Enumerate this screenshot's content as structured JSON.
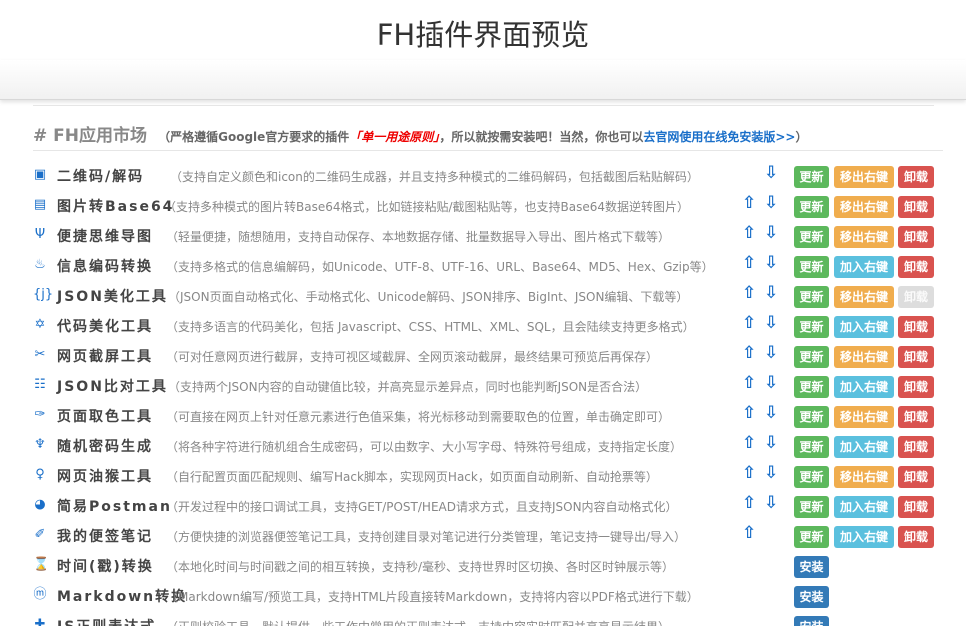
{
  "page_title": "FH插件界面预览",
  "market": {
    "title": "# FH应用市场",
    "note_prefix": "（严格遵循Google官方要求的插件",
    "note_red": "「单一用途原则」",
    "note_mid": "，所以就按需安装吧！当然，你也可以",
    "note_link": "去官网使用在线免安装版>>",
    "note_suffix": "）"
  },
  "labels": {
    "update": "更新",
    "install": "安装",
    "remove_menu": "移出右键",
    "add_menu": "加入右键",
    "uninstall": "卸载",
    "up_arrow": "⇧",
    "down_arrow": "⇩"
  },
  "colors": {
    "update": "#5cb85c",
    "install": "#337ab7",
    "remove_menu": "#f0ad4e",
    "add_menu": "#5bc0de",
    "uninstall": "#d9534f",
    "accent": "#1a6fc9"
  },
  "tools": [
    {
      "icon": "qrcode-icon",
      "glyph": "▣",
      "name": "二维码/解码",
      "desc": "（支持自定义颜色和icon的二维码生成器，并且支持多种模式的二维码解码，包括截图后粘贴解码）",
      "up": false,
      "down": true,
      "status": "installed",
      "menu": "remove",
      "uninstall_enabled": true
    },
    {
      "icon": "image-icon",
      "glyph": "▤",
      "name": "图片转Base64",
      "desc": "（支持多种模式的图片转Base64格式，比如链接粘贴/截图粘贴等，也支持Base64数据逆转图片）",
      "up": true,
      "down": true,
      "status": "installed",
      "menu": "remove",
      "uninstall_enabled": true
    },
    {
      "icon": "mindmap-icon",
      "glyph": "Ψ",
      "name": "便捷思维导图",
      "desc": "（轻量便捷，随想随用，支持自动保存、本地数据存储、批量数据导入导出、图片格式下载等）",
      "up": true,
      "down": true,
      "status": "installed",
      "menu": "remove",
      "uninstall_enabled": true
    },
    {
      "icon": "encode-icon",
      "glyph": "♨",
      "name": "信息编码转换",
      "desc": "（支持多格式的信息编解码，如Unicode、UTF-8、UTF-16、URL、Base64、MD5、Hex、Gzip等）",
      "up": true,
      "down": true,
      "status": "installed",
      "menu": "add",
      "uninstall_enabled": true
    },
    {
      "icon": "json-icon",
      "glyph": "{j}",
      "name": "JSON美化工具",
      "desc": "（JSON页面自动格式化、手动格式化、Unicode解码、JSON排序、BigInt、JSON编辑、下载等）",
      "up": true,
      "down": true,
      "status": "installed",
      "menu": "remove",
      "uninstall_enabled": false
    },
    {
      "icon": "code-icon",
      "glyph": "✡",
      "name": "代码美化工具",
      "desc": "（支持多语言的代码美化，包括 Javascript、CSS、HTML、XML、SQL，且会陆续支持更多格式）",
      "up": true,
      "down": true,
      "status": "installed",
      "menu": "add",
      "uninstall_enabled": true
    },
    {
      "icon": "scissors-icon",
      "glyph": "✂",
      "name": "网页截屏工具",
      "desc": "（可对任意网页进行截屏，支持可视区域截屏、全网页滚动截屏，最终结果可预览后再保存）",
      "up": true,
      "down": true,
      "status": "installed",
      "menu": "remove",
      "uninstall_enabled": true
    },
    {
      "icon": "compare-icon",
      "glyph": "☷",
      "name": "JSON比对工具",
      "desc": "（支持两个JSON内容的自动键值比较，并高亮显示差异点，同时也能判断JSON是否合法）",
      "up": true,
      "down": true,
      "status": "installed",
      "menu": "add",
      "uninstall_enabled": true
    },
    {
      "icon": "color-picker-icon",
      "glyph": "✑",
      "name": "页面取色工具",
      "desc": "（可直接在网页上针对任意元素进行色值采集，将光标移动到需要取色的位置，单击确定即可）",
      "up": true,
      "down": true,
      "status": "installed",
      "menu": "remove",
      "uninstall_enabled": true
    },
    {
      "icon": "key-icon",
      "glyph": "♆",
      "name": "随机密码生成",
      "desc": "（将各种字符进行随机组合生成密码，可以由数字、大小写字母、特殊符号组成，支持指定长度）",
      "up": true,
      "down": true,
      "status": "installed",
      "menu": "add",
      "uninstall_enabled": true
    },
    {
      "icon": "monkey-icon",
      "glyph": "♀",
      "name": "网页油猴工具",
      "desc": "（自行配置页面匹配规则、编写Hack脚本，实现网页Hack，如页面自动刷新、自动抢票等）",
      "up": true,
      "down": true,
      "status": "installed",
      "menu": "remove",
      "uninstall_enabled": true
    },
    {
      "icon": "postman-icon",
      "glyph": "◕",
      "name": "简易Postman",
      "desc": "（开发过程中的接口调试工具，支持GET/POST/HEAD请求方式，且支持JSON内容自动格式化）",
      "up": true,
      "down": true,
      "status": "installed",
      "menu": "add",
      "uninstall_enabled": true
    },
    {
      "icon": "note-icon",
      "glyph": "✐",
      "name": "我的便签笔记",
      "desc": "（方便快捷的浏览器便签笔记工具，支持创建目录对笔记进行分类管理，笔记支持一键导出/导入）",
      "up": true,
      "down": false,
      "status": "installed",
      "menu": "add",
      "uninstall_enabled": true
    },
    {
      "icon": "hourglass-icon",
      "glyph": "⌛",
      "name": "时间(戳)转换",
      "desc": "（本地化时间与时间戳之间的相互转换，支持秒/毫秒、支持世界时区切换、各时区时钟展示等）",
      "up": false,
      "down": false,
      "status": "not_installed",
      "menu": "none",
      "uninstall_enabled": false
    },
    {
      "icon": "markdown-icon",
      "glyph": "ⓜ",
      "name": "Markdown转换",
      "desc": "（Markdown编写/预览工具，支持HTML片段直接转Markdown，支持将内容以PDF格式进行下载）",
      "up": false,
      "down": false,
      "status": "not_installed",
      "menu": "none",
      "uninstall_enabled": false
    },
    {
      "icon": "regex-icon",
      "glyph": "✚",
      "name": "JS正则表达式",
      "desc": "（正则校验工具，默认提供一些工作中常用的正则表达式，支持内容实时匹配并高亮显示结果）",
      "up": false,
      "down": false,
      "status": "not_installed",
      "menu": "none",
      "uninstall_enabled": false
    }
  ]
}
